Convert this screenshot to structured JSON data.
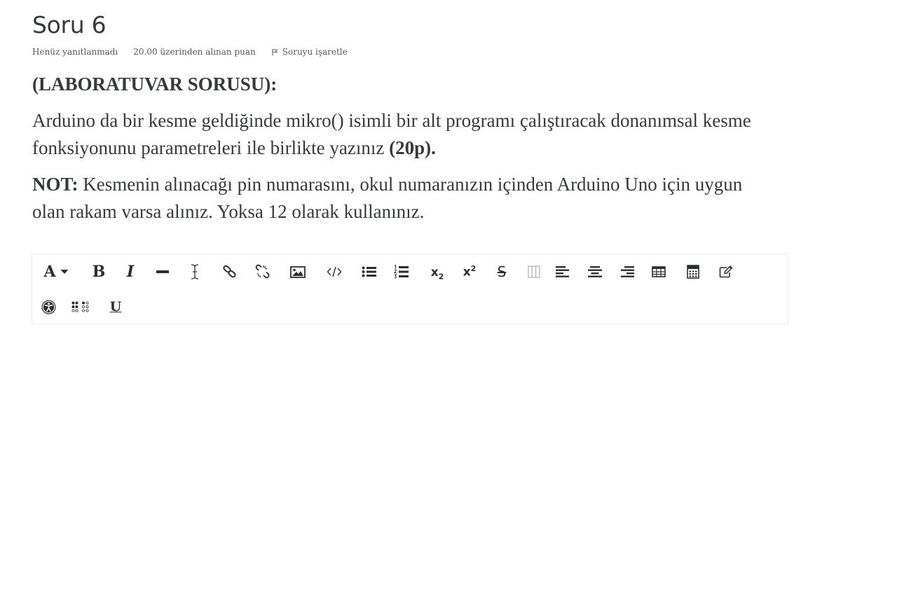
{
  "question": {
    "title": "Soru 6",
    "status": "Henüz yanıtlanmadı",
    "grade": "20.00 üzerinden alınan puan",
    "flag_label": "Soruyu işaretle"
  },
  "content": {
    "lab_heading": "(LABORATUVAR SORUSU):",
    "paragraph1_text": "Arduino da bir kesme geldiğinde  mikro() isimli bir alt programı çalıştıracak donanımsal kesme fonksiyonunu parametreleri ile birlikte yazınız ",
    "paragraph1_bold": "(20p).",
    "note_label": "NOT:",
    "note_text": " Kesmenin alınacağı pin numarasını, okul numaranızın içinden Arduino Uno için uygun olan rakam varsa alınız. Yoksa 12 olarak kullanınız."
  },
  "toolbar": {
    "font_letter": "A",
    "bold_letter": "B",
    "italic_letter": "I",
    "subscript_base": "x",
    "subscript_mark": "2",
    "superscript_base": "x",
    "superscript_mark": "2",
    "strike_letter": "S",
    "underline_letter": "U",
    "row1_icons": [
      "font-style-icon",
      "bold-icon",
      "italic-icon",
      "horizontal-rule-icon",
      "text-cursor-icon",
      "link-icon",
      "unlink-icon",
      "image-icon",
      "code-icon",
      "unordered-list-icon",
      "ordered-list-icon",
      "subscript-icon",
      "superscript-icon",
      "strikethrough-icon",
      "columns-icon",
      "align-left-icon",
      "align-center-icon",
      "align-right-icon",
      "table-icon",
      "calculator-icon",
      "edit-icon"
    ],
    "row2_icons": [
      "accessibility-icon",
      "braille-icon",
      "underline-icon"
    ]
  }
}
